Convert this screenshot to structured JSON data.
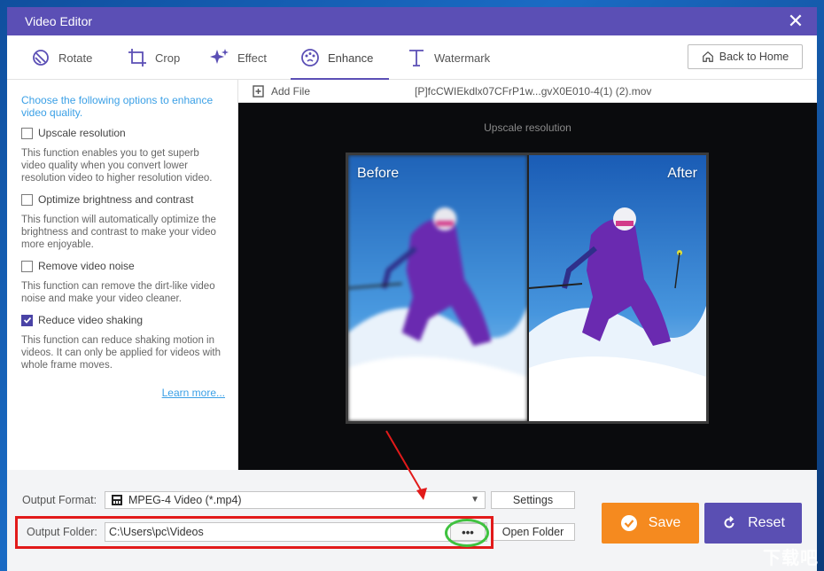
{
  "window": {
    "title": "Video Editor"
  },
  "tabs": [
    {
      "label": "Rotate",
      "icon": "rotate-icon"
    },
    {
      "label": "Crop",
      "icon": "crop-icon"
    },
    {
      "label": "Effect",
      "icon": "effect-icon"
    },
    {
      "label": "Enhance",
      "icon": "enhance-icon",
      "active": true
    },
    {
      "label": "Watermark",
      "icon": "watermark-icon"
    }
  ],
  "back_home": "Back to Home",
  "enhance": {
    "intro": "Choose the following options to enhance video quality.",
    "options": [
      {
        "label": "Upscale resolution",
        "checked": false,
        "desc": "This function enables you to get superb video quality when you convert lower resolution video to higher resolution video."
      },
      {
        "label": "Optimize brightness and contrast",
        "checked": false,
        "desc": "This function will automatically optimize the brightness and contrast to make your video more enjoyable."
      },
      {
        "label": "Remove video noise",
        "checked": false,
        "desc": "This function can remove the dirt-like video noise and make your video cleaner."
      },
      {
        "label": "Reduce video shaking",
        "checked": true,
        "desc": "This function can reduce shaking motion in videos. It can only be applied for videos with whole frame moves."
      }
    ],
    "learn_more": "Learn more..."
  },
  "filebar": {
    "add_file": "Add File",
    "filename": "[P]fcCWIEkdlx07CFrP1w...gvX0E010-4(1) (2).mov"
  },
  "preview": {
    "label": "Upscale resolution",
    "before": "Before",
    "after": "After"
  },
  "output": {
    "format_label": "Output Format:",
    "format_value": "MPEG-4 Video (*.mp4)",
    "settings": "Settings",
    "folder_label": "Output Folder:",
    "folder_value": "C:\\Users\\pc\\Videos",
    "browse": "•••",
    "open_folder": "Open Folder"
  },
  "actions": {
    "save": "Save",
    "reset": "Reset"
  },
  "watermark": "下载吧",
  "colors": {
    "accent": "#5b4fb5",
    "save": "#f58a1f",
    "reset": "#5a4fb3",
    "link": "#3ba0e6",
    "annotation_red": "#e21a1a",
    "annotation_green": "#3fc23f"
  }
}
